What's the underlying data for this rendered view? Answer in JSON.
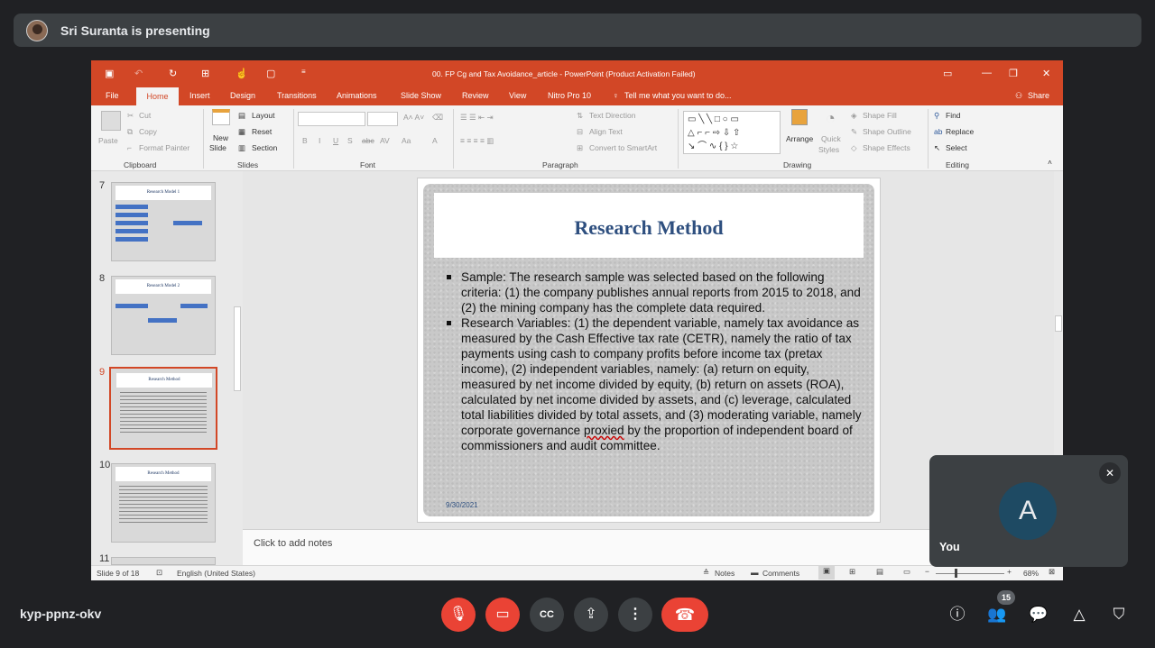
{
  "presenter": {
    "label": "Sri Suranta is presenting"
  },
  "powerpoint": {
    "window_title": "00. FP Cg and Tax Avoidance_article - PowerPoint (Product Activation Failed)",
    "tabs": [
      "File",
      "Home",
      "Insert",
      "Design",
      "Transitions",
      "Animations",
      "Slide Show",
      "Review",
      "View",
      "Nitro Pro 10"
    ],
    "tell_me": "Tell me what you want to do...",
    "share": "Share",
    "ribbon": {
      "clipboard": {
        "paste": "Paste",
        "cut": "Cut",
        "copy": "Copy",
        "format_painter": "Format Painter",
        "label": "Clipboard"
      },
      "slides": {
        "new_slide": "New",
        "new_slide2": "Slide",
        "layout": "Layout",
        "reset": "Reset",
        "section": "Section",
        "label": "Slides"
      },
      "font": {
        "label": "Font",
        "buttons": [
          "B",
          "I",
          "U",
          "S",
          "abc",
          "AV",
          "Aa",
          "A"
        ]
      },
      "paragraph": {
        "text_direction": "Text Direction",
        "align_text": "Align Text",
        "convert": "Convert to SmartArt",
        "label": "Paragraph"
      },
      "drawing": {
        "arrange": "Arrange",
        "quick_styles": "Quick",
        "quick_styles2": "Styles",
        "shape_fill": "Shape Fill",
        "shape_outline": "Shape Outline",
        "shape_effects": "Shape Effects",
        "label": "Drawing"
      },
      "editing": {
        "find": "Find",
        "replace": "Replace",
        "select": "Select",
        "label": "Editing"
      }
    },
    "thumbnails": [
      {
        "num": "7",
        "title": "Research Model 1"
      },
      {
        "num": "8",
        "title": "Research Model 2"
      },
      {
        "num": "9",
        "title": "Research Method"
      },
      {
        "num": "10",
        "title": "Research Method"
      },
      {
        "num": "11",
        "title": ""
      }
    ],
    "slide": {
      "title": "Research Method",
      "bullet1": "Sample: The research sample was selected based on the following criteria: (1) the company publishes annual reports from 2015 to 2018, and (2) the mining company has the complete data required.",
      "bullet2_a": "Research Variables: (1) the dependent variable, namely tax avoidance as measured by the Cash Effective tax rate (CETR), namely the ratio of tax payments using cash to company profits before income tax (pretax income), (2) independent variables, namely: (a) return on equity, measured by net income divided by equity, (b) return on assets (ROA), calculated by net income divided by assets, and (c) leverage, calculated total liabilities divided by total assets, and (3) moderating variable, namely corporate governance ",
      "bullet2_squig": "proxied",
      "bullet2_b": " by the proportion of independent board of commissioners and audit committee.",
      "date": "9/30/2021"
    },
    "notes_placeholder": "Click to add notes",
    "status": {
      "slide": "Slide 9 of 18",
      "language": "English (United States)",
      "notes": "Notes",
      "comments": "Comments",
      "zoom": "68%"
    }
  },
  "self_tile": {
    "initial": "A",
    "name": "You"
  },
  "meeting_code": "kyp-ppnz-okv",
  "people_count": "15",
  "colors": {
    "ppt_accent": "#d24726",
    "meet_red": "#ea4335",
    "meet_bg": "#202124"
  }
}
